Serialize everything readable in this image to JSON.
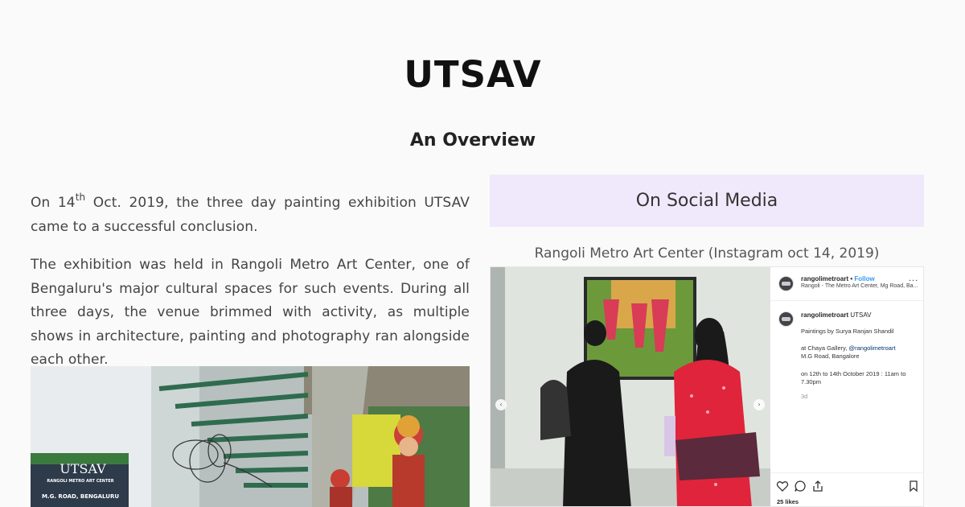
{
  "page": {
    "title": "UTSAV",
    "subtitle": "An Overview"
  },
  "article": {
    "para1_a": "On 14",
    "para1_sup": "th",
    "para1_b": " Oct. 2019, the three day painting exhibition UTSAV came to a successful conclusion.",
    "para2": "The exhibition was held in Rangoli Metro Art Center, one of Bengaluru's major cultural spaces for such events. During all three days, the venue brimmed with activity, as multiple shows in architecture, painting and photography ran alongside each other.",
    "poster_title": "UTSAV",
    "poster_line1": "RANGOLI METRO ART CENTER",
    "poster_line2": "M.G. ROAD, BENGALURU"
  },
  "social": {
    "heading": "On Social Media",
    "caption": "Rangoli Metro Art Center (Instagram oct 14, 2019)"
  },
  "instagram": {
    "username": "rangolimetroart",
    "follow_sep": " • ",
    "follow_label": "Follow",
    "location": "Rangoli - The Metro Art Center, Mg Road, Ba...",
    "more": "...",
    "caption_user": "rangolimetroart",
    "caption_title": " UTSAV",
    "caption_line1": "Paintings by Surya Ranjan Shandil",
    "caption_line2a": "at Chaya Gallery, ",
    "caption_mention": "@rangolimetroart",
    "caption_line3": "M.G Road, Bangalore",
    "caption_line4": "on 12th to 14th October 2019 : 11am to 7.30pm",
    "time_ago": "3d",
    "likes": "25 likes",
    "prev": "‹",
    "next": "›"
  },
  "colors": {
    "background": "#fafafa",
    "social_box": "#efe9fb",
    "follow_blue": "#3897f0"
  },
  "icons": [
    "heart-icon",
    "comment-icon",
    "share-icon",
    "bookmark-icon",
    "prev-arrow-icon",
    "next-arrow-icon",
    "more-icon"
  ]
}
